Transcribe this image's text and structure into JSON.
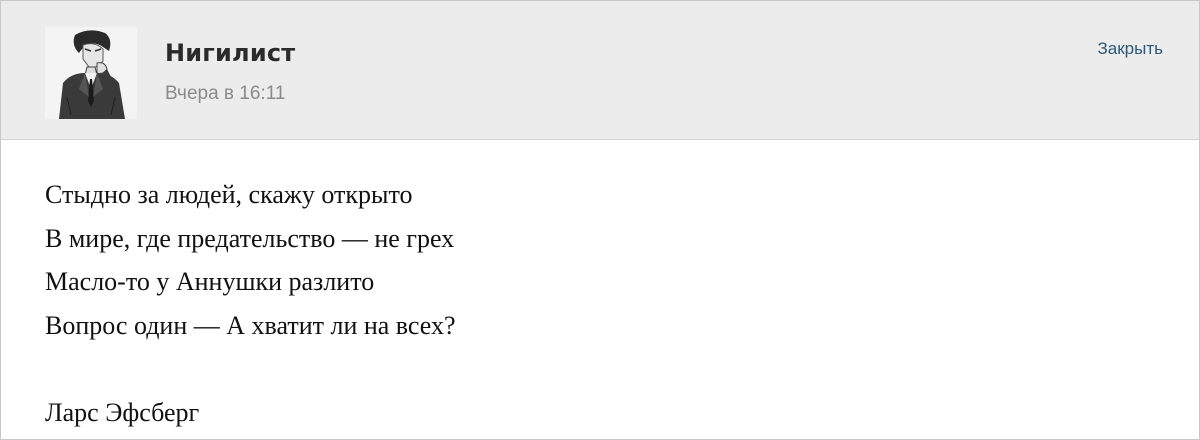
{
  "post": {
    "author": "Нигилист",
    "timestamp": "Вчера в 16:11",
    "close_label": "Закрыть",
    "avatar_icon": "illustrated-man-avatar",
    "lines": [
      "Стыдно за людей, скажу открыто",
      "В мире, где предательство — не грех",
      "Масло-то у Аннушки разлито",
      "Вопрос один — А хватит ли на всех?"
    ],
    "signature": "Ларс Эфсберг"
  }
}
